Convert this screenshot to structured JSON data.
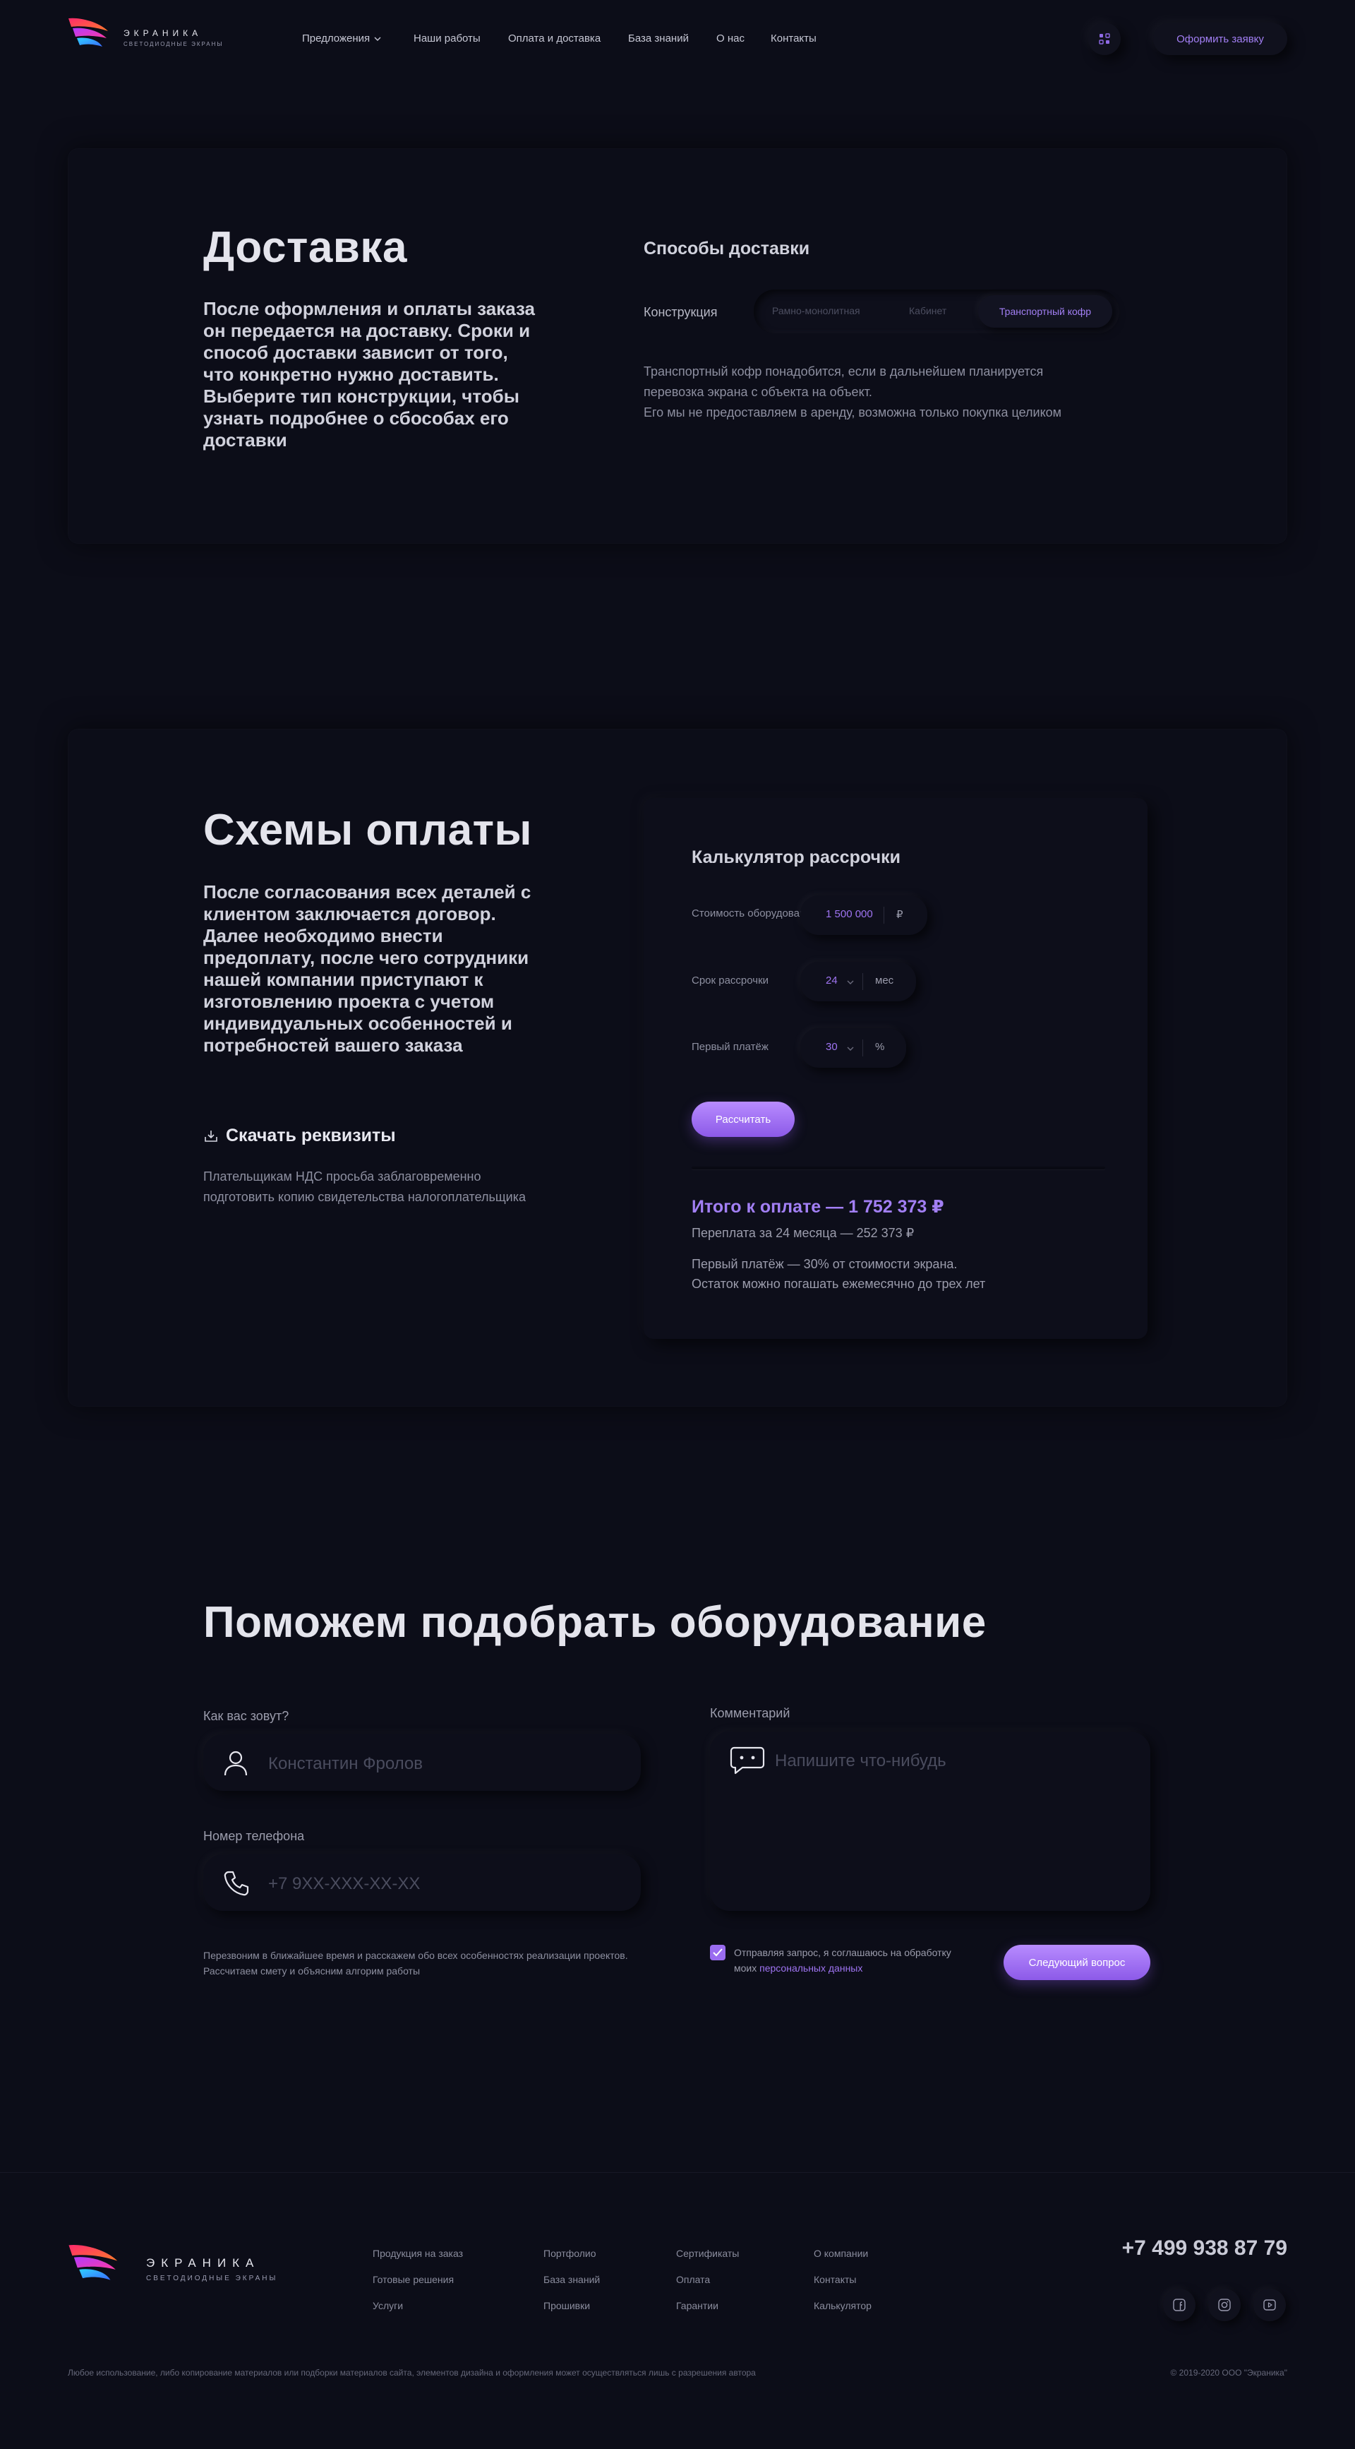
{
  "header": {
    "brand": "ЭКРАНИКА",
    "tagline": "СВЕТОДИОДНЫЕ ЭКРАНЫ",
    "nav": [
      "Предложения",
      "Наши работы",
      "Оплата и доставка",
      "База знаний",
      "О нас",
      "Контакты"
    ],
    "cta": "Оформить заявку",
    "icon": "grid-icon"
  },
  "delivery": {
    "title": "Доставка",
    "lead": "После оформления и оплаты заказа он передается на доставку. Сроки и способ доставки зависит от того, что конкретно нужно доставить. Выберите тип конструкции, чтобы узнать подробнее о сбособах его доставки",
    "methods_title": "Способы доставки",
    "construction_label": "Конструкция",
    "options": [
      "Рамно-монолитная",
      "Кабинет",
      "Транспортный кофр"
    ],
    "selected": "Транспортный кофр",
    "desc_line1": "Транспортный кофр понадобится, если в дальнейшем планируется",
    "desc_line2": "перевозка экрана с объекта на объект.",
    "desc_line3": "Его мы не предоставляем в аренду, возможна только покупка целиком"
  },
  "payment": {
    "title": "Схемы оплаты",
    "lead": "После согласования всех деталей с клиентом заключается договор. Далее необходимо внести предоплату, после чего сотрудники нашей компании приступают к изготовлению проекта с учетом индивидуальных особенностей и потребностей вашего заказа",
    "download": "Скачать реквизиты",
    "note": "Плательщикам НДС просьба заблаговременно подготовить копию свидетельства налогоплательщика",
    "calc": {
      "title": "Калькулятор рассрочки",
      "cost_label": "Стоимость оборудования",
      "cost_value": "1 500 000",
      "cost_unit": "₽",
      "term_label": "Срок рассрочки",
      "term_value": "24",
      "term_unit": "мес",
      "first_label": "Первый платёж",
      "first_value": "30",
      "first_unit": "%",
      "button": "Рассчитать",
      "total": "Итого к оплате — 1 752 373 ₽",
      "overpay": "Переплата за 24 месяца — 252 373 ₽",
      "info1": "Первый платёж — 30% от стоимости экрана.",
      "info2": "Остаток можно погашать ежемесячно до трех лет"
    }
  },
  "form": {
    "title": "Поможем подобрать оборудование",
    "name_label": "Как вас зовут?",
    "name_placeholder": "Константин Фролов",
    "phone_label": "Номер телефона",
    "phone_placeholder": "+7 9XX-XXX-XX-XX",
    "comment_label": "Комментарий",
    "comment_placeholder": "Напишите что-нибудь",
    "hint": "Перезвоним в ближайшее время и расскажем обо всех особенностях реализации проектов. Рассчитаем смету и объясним алгорим работы",
    "consent_1": "Отправляя запрос, я соглашаюсь на обработку",
    "consent_2": "моих",
    "consent_link": "персональных данных",
    "submit": "Следующий вопрос"
  },
  "footer": {
    "brand": "ЭКРАНИКА",
    "tagline": "СВЕТОДИОДНЫЕ ЭКРАНЫ",
    "col1": [
      "Продукция на заказ",
      "Готовые решения",
      "Услуги"
    ],
    "col2": [
      "Портфолио",
      "База знаний",
      "Прошивки"
    ],
    "col3": [
      "Сертификаты",
      "Оплата",
      "Гарантии"
    ],
    "col4": [
      "О компании",
      "Контакты",
      "Калькулятор"
    ],
    "phone": "+7 499 938 87 79",
    "social": [
      "facebook-icon",
      "instagram-icon",
      "youtube-icon"
    ],
    "legal": "Любое использование, либо копирование материалов или подборки материалов сайта, элементов дизайна и оформления может осуществляться лишь с разрешения автора",
    "copyright": "© 2019-2020 ООО \"Экраника\""
  },
  "colors": {
    "bg": "#0c0d18",
    "accent": "#9f74f2",
    "button": "#a878f8"
  }
}
